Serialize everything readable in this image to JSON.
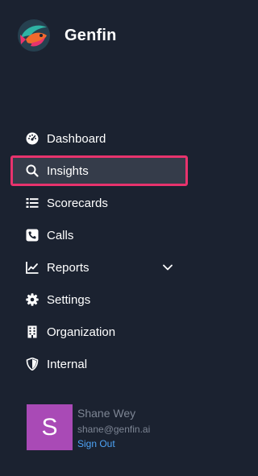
{
  "brand": {
    "name": "Genfin",
    "logo_icon": "fish-logo-icon"
  },
  "nav": {
    "items": [
      {
        "label": "Dashboard",
        "icon": "dashboard-gauge-icon"
      },
      {
        "label": "Insights",
        "icon": "search-icon",
        "active": true
      },
      {
        "label": "Scorecards",
        "icon": "list-icon"
      },
      {
        "label": "Calls",
        "icon": "phone-icon"
      },
      {
        "label": "Reports",
        "icon": "chart-line-icon",
        "has_submenu": true
      },
      {
        "label": "Settings",
        "icon": "gear-icon"
      },
      {
        "label": "Organization",
        "icon": "building-icon"
      },
      {
        "label": "Internal",
        "icon": "shield-icon"
      }
    ]
  },
  "user": {
    "initial": "S",
    "name": "Shane Wey",
    "email": "shane@genfin.ai",
    "sign_out_label": "Sign Out"
  },
  "colors": {
    "background": "#1b2230",
    "active_border": "#e8336d",
    "active_bg": "#353c4a",
    "avatar_bg": "#a94ab6",
    "link": "#4da3f5",
    "muted_text": "#7d8594"
  }
}
